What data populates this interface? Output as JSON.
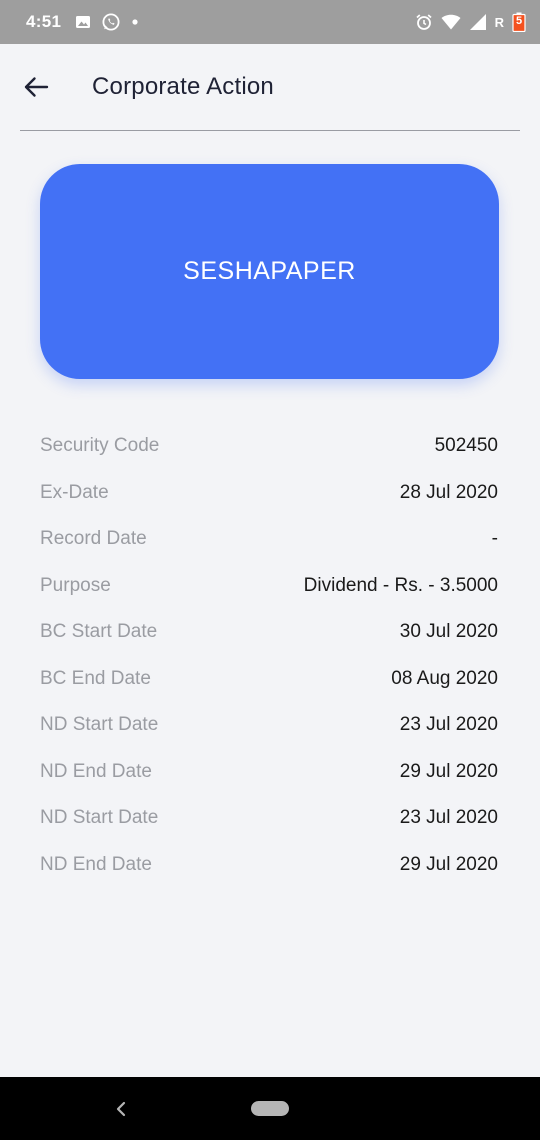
{
  "status_bar": {
    "time": "4:51",
    "icons_left": [
      "image-icon",
      "whatsapp-icon",
      "dot-icon"
    ],
    "icons_right": [
      "alarm-icon",
      "wifi-icon",
      "signal-icon",
      "roaming-r",
      "battery-icon"
    ],
    "roaming_label": "R",
    "battery_level": "5"
  },
  "app_bar": {
    "title": "Corporate Action",
    "back_icon": "arrow-left-icon"
  },
  "card": {
    "security_name": "SESHAPAPER",
    "color": "#4371f5"
  },
  "details": [
    {
      "label": "Security Code",
      "value": "502450"
    },
    {
      "label": "Ex-Date",
      "value": "28 Jul 2020"
    },
    {
      "label": "Record Date",
      "value": "-"
    },
    {
      "label": "Purpose",
      "value": "Dividend - Rs. - 3.5000"
    },
    {
      "label": "BC Start Date",
      "value": "30 Jul 2020"
    },
    {
      "label": "BC End Date",
      "value": "08 Aug 2020"
    },
    {
      "label": "ND Start Date",
      "value": "23 Jul 2020"
    },
    {
      "label": "ND End Date",
      "value": "29 Jul 2020"
    },
    {
      "label": "ND Start Date",
      "value": "23 Jul 2020"
    },
    {
      "label": "ND End Date",
      "value": "29 Jul 2020"
    }
  ],
  "nav_bar": {
    "icons": [
      "nav-back-icon",
      "nav-home-pill"
    ]
  }
}
